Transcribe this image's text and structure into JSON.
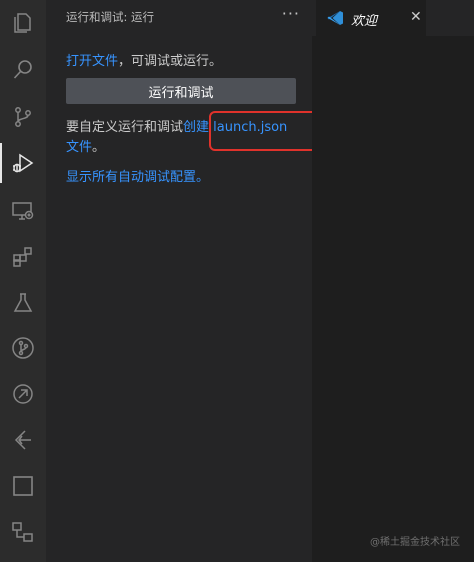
{
  "activity_bar": {
    "items": [
      {
        "icon": "files-icon"
      },
      {
        "icon": "search-icon"
      },
      {
        "icon": "source-control-icon"
      },
      {
        "icon": "run-debug-icon",
        "active": true
      },
      {
        "icon": "remote-explorer-icon"
      },
      {
        "icon": "extensions-icon"
      },
      {
        "icon": "testing-icon"
      },
      {
        "icon": "git-graph-icon"
      },
      {
        "icon": "timeline-icon"
      },
      {
        "icon": "gitlens-icon"
      },
      {
        "icon": "square-icon"
      },
      {
        "icon": "structure-icon"
      }
    ]
  },
  "panel": {
    "title": "运行和调试: 运行",
    "more": "···",
    "open_file_link": "打开文件",
    "open_file_suffix": "，可调试或运行。",
    "run_button": "运行和调试",
    "customize_prefix": "要自定义运行和调试",
    "create_link": "创建 launch.json 文件",
    "customize_suffix": "。",
    "show_all_link": "显示所有自动调试配置。"
  },
  "editor": {
    "tab_label": "欢迎",
    "tab_close": "✕"
  },
  "watermark": "@稀土掘金技术社区",
  "colors": {
    "link": "#3794ff",
    "highlight": "#e0322b",
    "button": "#4e5157",
    "vscode_blue": "#2f8fd8"
  }
}
